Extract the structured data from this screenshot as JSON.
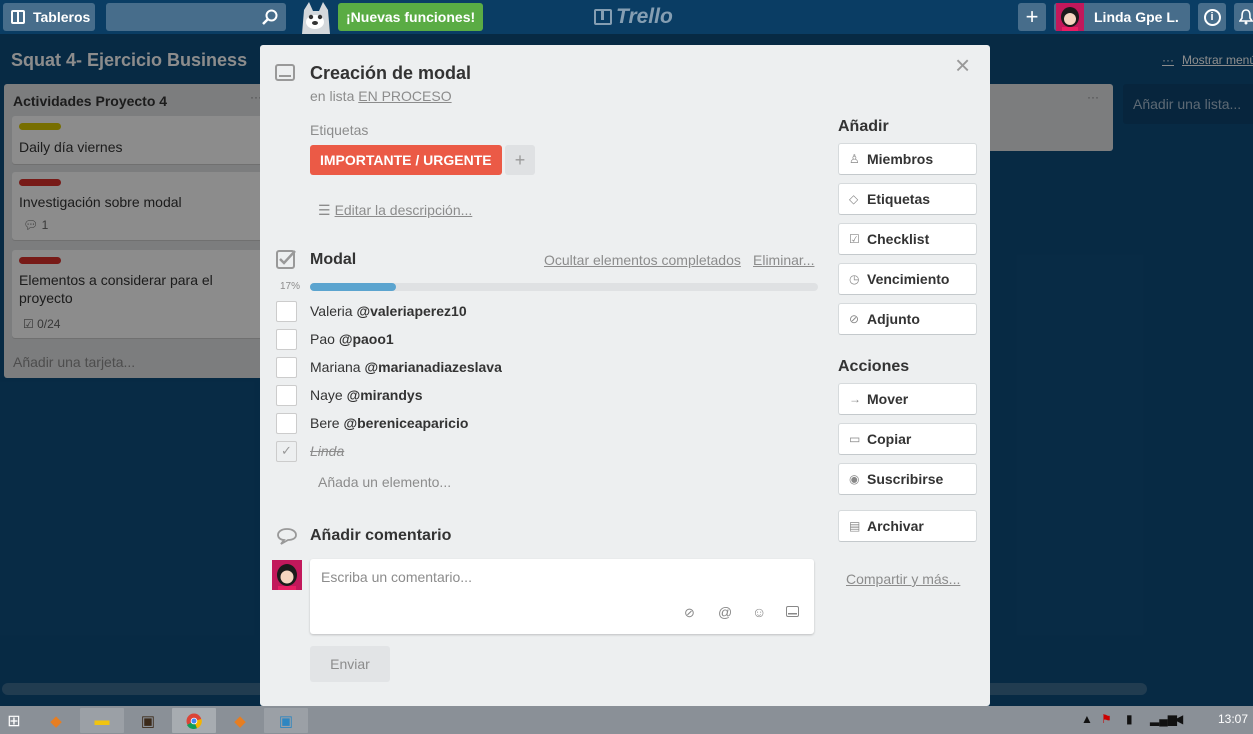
{
  "topbar": {
    "boards_label": "Tableros",
    "new_features": "¡Nuevas funciones!",
    "logo": "Trello",
    "user_name": "Linda Gpe L.",
    "add_symbol": "+",
    "info_symbol": "i"
  },
  "board": {
    "title": "Squat 4- Ejercicio Business",
    "show_menu": "Mostrar menú",
    "lists": [
      {
        "title": "Actividades Proyecto 4",
        "cards": [
          {
            "label_color": "#d9c800",
            "title": "Daily día viernes"
          },
          {
            "label_color": "#d9312b",
            "title": "Investigación sobre modal",
            "comments": "1"
          },
          {
            "label_color": "#d9312b",
            "title": "Elementos a considerar para el proyecto",
            "checklist": "0/24"
          }
        ],
        "add_card": "Añadir una tarjeta..."
      }
    ],
    "add_list": "Añadir una lista..."
  },
  "modal": {
    "title": "Creación de modal",
    "in_list_prefix": "en lista",
    "list_name": "EN PROCESO",
    "labels_heading": "Etiquetas",
    "label": {
      "text": "IMPORTANTE / URGENTE",
      "color": "#eb5a46"
    },
    "edit_description": "Editar la descripción...",
    "checklist": {
      "title": "Modal",
      "hide_completed": "Ocultar elementos completados",
      "delete": "Eliminar...",
      "progress_label": "17%",
      "progress": 0.17,
      "items": [
        {
          "name": "Valeria",
          "handle": "@valeriaperez10",
          "done": false
        },
        {
          "name": "Pao",
          "handle": "@paoo1",
          "done": false
        },
        {
          "name": "Mariana",
          "handle": "@marianadiazeslava",
          "done": false
        },
        {
          "name": "Naye",
          "handle": "@mirandys",
          "done": false
        },
        {
          "name": "Bere",
          "handle": "@bereniceaparicio",
          "done": false
        },
        {
          "name": "Linda",
          "handle": "",
          "done": true
        }
      ],
      "add_item": "Añada un elemento..."
    },
    "comment": {
      "heading": "Añadir comentario",
      "placeholder": "Escriba un comentario...",
      "send": "Enviar"
    },
    "sidebar": {
      "add_heading": "Añadir",
      "add_buttons": [
        "Miembros",
        "Etiquetas",
        "Checklist",
        "Vencimiento",
        "Adjunto"
      ],
      "actions_heading": "Acciones",
      "action_buttons": [
        "Mover",
        "Copiar",
        "Suscribirse"
      ],
      "archive": "Archivar",
      "share": "Compartir y más..."
    }
  },
  "taskbar": {
    "clock": "13:07"
  },
  "colors": {
    "board_bg": "#0e4e7d",
    "progress": "#5ba4cf",
    "new_features_bg": "#5aac44"
  }
}
